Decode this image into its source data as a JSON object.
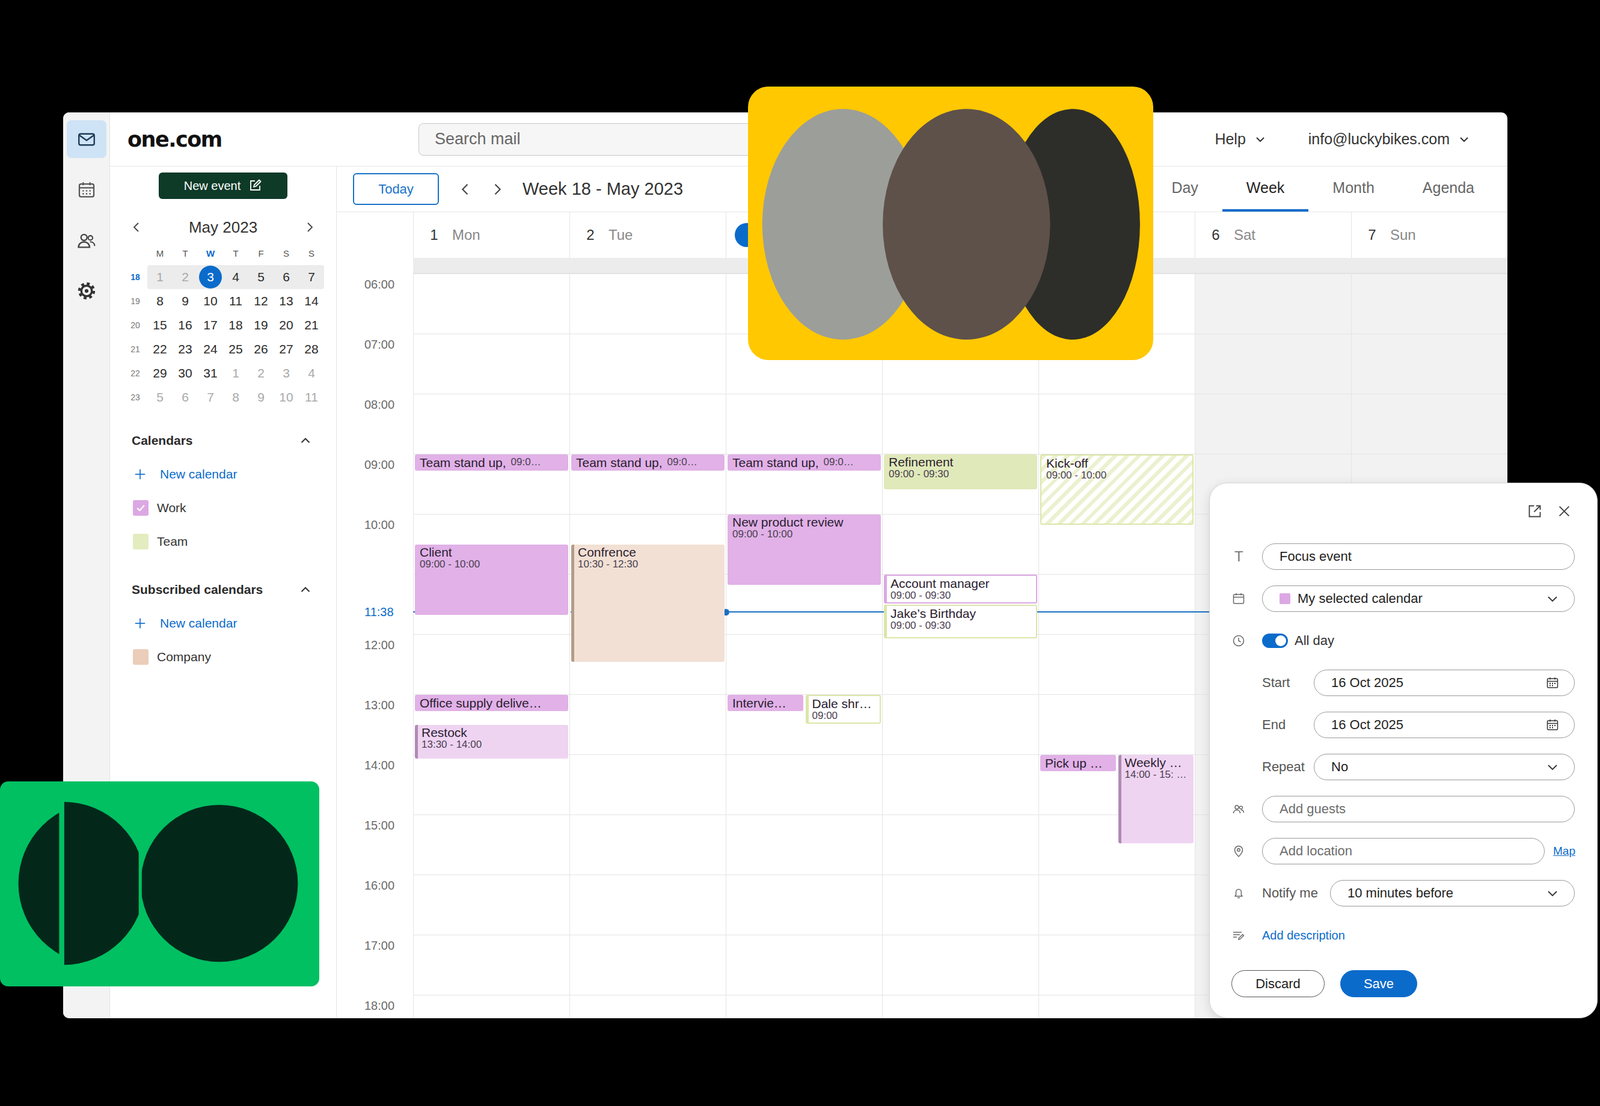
{
  "app": {
    "logo": "one.com",
    "search": {
      "placeholder": "Search mail"
    },
    "help": "Help",
    "account": "info@luckybikes.com"
  },
  "rail": [
    {
      "selected": true
    },
    {
      "selected": false
    },
    {
      "selected": false
    },
    {
      "selected": false
    }
  ],
  "sidebar": {
    "new_event": "New event",
    "mini_calendar": {
      "title": "May 2023",
      "weekdays": [
        {
          "label": "M",
          "today": false
        },
        {
          "label": "T",
          "today": false
        },
        {
          "label": "W",
          "today": true
        },
        {
          "label": "T",
          "today": false
        },
        {
          "label": "F",
          "today": false
        },
        {
          "label": "S",
          "today": false
        },
        {
          "label": "S",
          "today": false
        }
      ],
      "weeks": [
        {
          "week": "18",
          "current": true,
          "days": [
            {
              "day": "1",
              "muted": true,
              "selected": false
            },
            {
              "day": "2",
              "muted": true,
              "selected": false
            },
            {
              "day": "3",
              "muted": false,
              "selected": true
            },
            {
              "day": "4",
              "muted": false,
              "selected": false
            },
            {
              "day": "5",
              "muted": false,
              "selected": false
            },
            {
              "day": "6",
              "muted": false,
              "selected": false
            },
            {
              "day": "7",
              "muted": false,
              "selected": false
            }
          ]
        },
        {
          "week": "19",
          "current": false,
          "days": [
            {
              "day": "8",
              "muted": false,
              "selected": false
            },
            {
              "day": "9",
              "muted": false,
              "selected": false
            },
            {
              "day": "10",
              "muted": false,
              "selected": false
            },
            {
              "day": "11",
              "muted": false,
              "selected": false
            },
            {
              "day": "12",
              "muted": false,
              "selected": false
            },
            {
              "day": "13",
              "muted": false,
              "selected": false
            },
            {
              "day": "14",
              "muted": false,
              "selected": false
            }
          ]
        },
        {
          "week": "20",
          "current": false,
          "days": [
            {
              "day": "15",
              "muted": false,
              "selected": false
            },
            {
              "day": "16",
              "muted": false,
              "selected": false
            },
            {
              "day": "17",
              "muted": false,
              "selected": false
            },
            {
              "day": "18",
              "muted": false,
              "selected": false
            },
            {
              "day": "19",
              "muted": false,
              "selected": false
            },
            {
              "day": "20",
              "muted": false,
              "selected": false
            },
            {
              "day": "21",
              "muted": false,
              "selected": false
            }
          ]
        },
        {
          "week": "21",
          "current": false,
          "days": [
            {
              "day": "22",
              "muted": false,
              "selected": false
            },
            {
              "day": "23",
              "muted": false,
              "selected": false
            },
            {
              "day": "24",
              "muted": false,
              "selected": false
            },
            {
              "day": "25",
              "muted": false,
              "selected": false
            },
            {
              "day": "26",
              "muted": false,
              "selected": false
            },
            {
              "day": "27",
              "muted": false,
              "selected": false
            },
            {
              "day": "28",
              "muted": false,
              "selected": false
            }
          ]
        },
        {
          "week": "22",
          "current": false,
          "days": [
            {
              "day": "29",
              "muted": false,
              "selected": false
            },
            {
              "day": "30",
              "muted": false,
              "selected": false
            },
            {
              "day": "31",
              "muted": false,
              "selected": false
            },
            {
              "day": "1",
              "muted": true,
              "selected": false
            },
            {
              "day": "2",
              "muted": true,
              "selected": false
            },
            {
              "day": "3",
              "muted": true,
              "selected": false
            },
            {
              "day": "4",
              "muted": true,
              "selected": false
            }
          ]
        },
        {
          "week": "23",
          "current": false,
          "days": [
            {
              "day": "5",
              "muted": true,
              "selected": false
            },
            {
              "day": "6",
              "muted": true,
              "selected": false
            },
            {
              "day": "7",
              "muted": true,
              "selected": false
            },
            {
              "day": "8",
              "muted": true,
              "selected": false
            },
            {
              "day": "9",
              "muted": true,
              "selected": false
            },
            {
              "day": "10",
              "muted": true,
              "selected": false
            },
            {
              "day": "11",
              "muted": true,
              "selected": false
            }
          ]
        }
      ]
    },
    "sections": [
      {
        "title": "Calendars",
        "expanded": true,
        "add": "New calendar",
        "items": [
          {
            "label": "Work",
            "checked": true,
            "color": "#dca8e4"
          },
          {
            "label": "Team",
            "checked": false,
            "color": "#e3ecbf"
          }
        ]
      },
      {
        "title": "Subscribed calendars",
        "expanded": true,
        "add": "New calendar",
        "items": [
          {
            "label": "Company",
            "checked": false,
            "color": "#ebcdb9"
          }
        ]
      }
    ]
  },
  "toolbar": {
    "today": "Today",
    "title": "Week 18 - May 2023",
    "views": [
      {
        "label": "Day",
        "selected": false
      },
      {
        "label": "Week",
        "selected": true
      },
      {
        "label": "Month",
        "selected": false
      },
      {
        "label": "Agenda",
        "selected": false
      }
    ]
  },
  "days": [
    {
      "num": "1",
      "name": "Mon",
      "today": false,
      "weekend": false,
      "events": [
        {
          "title": "Team stand up,",
          "time": "09:0…",
          "kind": "solid",
          "color": "#e1b1e7"
        },
        {
          "title": "Client",
          "time": "09:00 - 10:00",
          "kind": "solid",
          "color": "#e1b1e7"
        },
        {
          "title": "Office supply delive…",
          "kind": "solid",
          "color": "#e1b1e7"
        },
        {
          "title": "Restock",
          "time": "13:30 - 14:00",
          "kind": "light",
          "color": "#e1b1e7"
        }
      ]
    },
    {
      "num": "2",
      "name": "Tue",
      "today": false,
      "weekend": false,
      "events": [
        {
          "title": "Team stand up,",
          "time": "09:0…",
          "kind": "solid",
          "color": "#e1b1e7"
        },
        {
          "title": "Confrence",
          "time": "10:30 - 12:30",
          "kind": "light",
          "color": "#e8c7b1"
        }
      ]
    },
    {
      "today": true,
      "weekend": false,
      "events": [
        {
          "title": "Team stand up,",
          "time": "09:0…",
          "kind": "solid",
          "color": "#e1b1e7"
        },
        {
          "title": "New product review",
          "time": "09:00 - 10:00",
          "kind": "solid",
          "color": "#e1b1e7"
        },
        {
          "title": "Intervie…",
          "kind": "solid",
          "color": "#e1b1e7"
        },
        {
          "title": "Dale shr…",
          "time": "09:00",
          "kind": "outline",
          "color": "#dbe6a8"
        }
      ]
    },
    {
      "today": false,
      "weekend": false,
      "events": [
        {
          "title": "Refinement",
          "time": "09:00 - 09:30",
          "kind": "solid",
          "color": "#e0e9b9"
        },
        {
          "title": "Account manager",
          "time": "09:00 - 09:30",
          "kind": "outline",
          "color": "#dca8e4"
        },
        {
          "title": "Jake’s Birthday",
          "time": "09:00 - 09:30",
          "kind": "outline",
          "color": "#dbe6a8"
        }
      ]
    },
    {
      "today": false,
      "weekend": false,
      "events": [
        {
          "title": "Kick-off",
          "time": "09:00 - 10:00",
          "kind": "striped",
          "color": "#dbe6a8"
        },
        {
          "title": "Pick up …",
          "kind": "solid",
          "color": "#e1b1e7"
        },
        {
          "title": "Weekly …",
          "time": "14:00 - 15: …",
          "kind": "light",
          "color": "#e1b1e7"
        }
      ]
    },
    {
      "num": "6",
      "name": "Sat",
      "today": false,
      "weekend": true,
      "events": []
    },
    {
      "num": "7",
      "name": "Sun",
      "today": false,
      "weekend": true,
      "events": []
    }
  ],
  "hours": [
    {
      "label": "06:00"
    },
    {
      "label": "07:00"
    },
    {
      "label": "08:00"
    },
    {
      "label": "09:00"
    },
    {
      "label": "10:00"
    },
    {},
    {
      "label": "12:00"
    },
    {
      "label": "13:00"
    },
    {
      "label": "14:00"
    },
    {
      "label": "15:00"
    },
    {
      "label": "16:00"
    },
    {
      "label": "17:00"
    },
    {
      "label": "18:00"
    }
  ],
  "now": {
    "label": "11:38"
  },
  "popup": {
    "title": {
      "icon": "T",
      "value": "Focus event"
    },
    "calendar": {
      "value": "My selected calendar",
      "color": "#dca8e4"
    },
    "all_day": {
      "label": "All day",
      "on": true
    },
    "start": {
      "label": "Start",
      "value": "16 Oct 2025"
    },
    "end": {
      "label": "End",
      "value": "16 Oct 2025"
    },
    "repeat": {
      "label": "Repeat",
      "value": "No"
    },
    "guests": {
      "placeholder": "Add guests"
    },
    "location": {
      "placeholder": "Add location",
      "link": "Map"
    },
    "notify": {
      "label": "Notify me",
      "value": "10 minutes before"
    },
    "description": {
      "link": "Add description"
    },
    "buttons": [
      {
        "label": "Discard",
        "primary": false
      },
      {
        "label": "Save",
        "primary": true
      }
    ]
  }
}
